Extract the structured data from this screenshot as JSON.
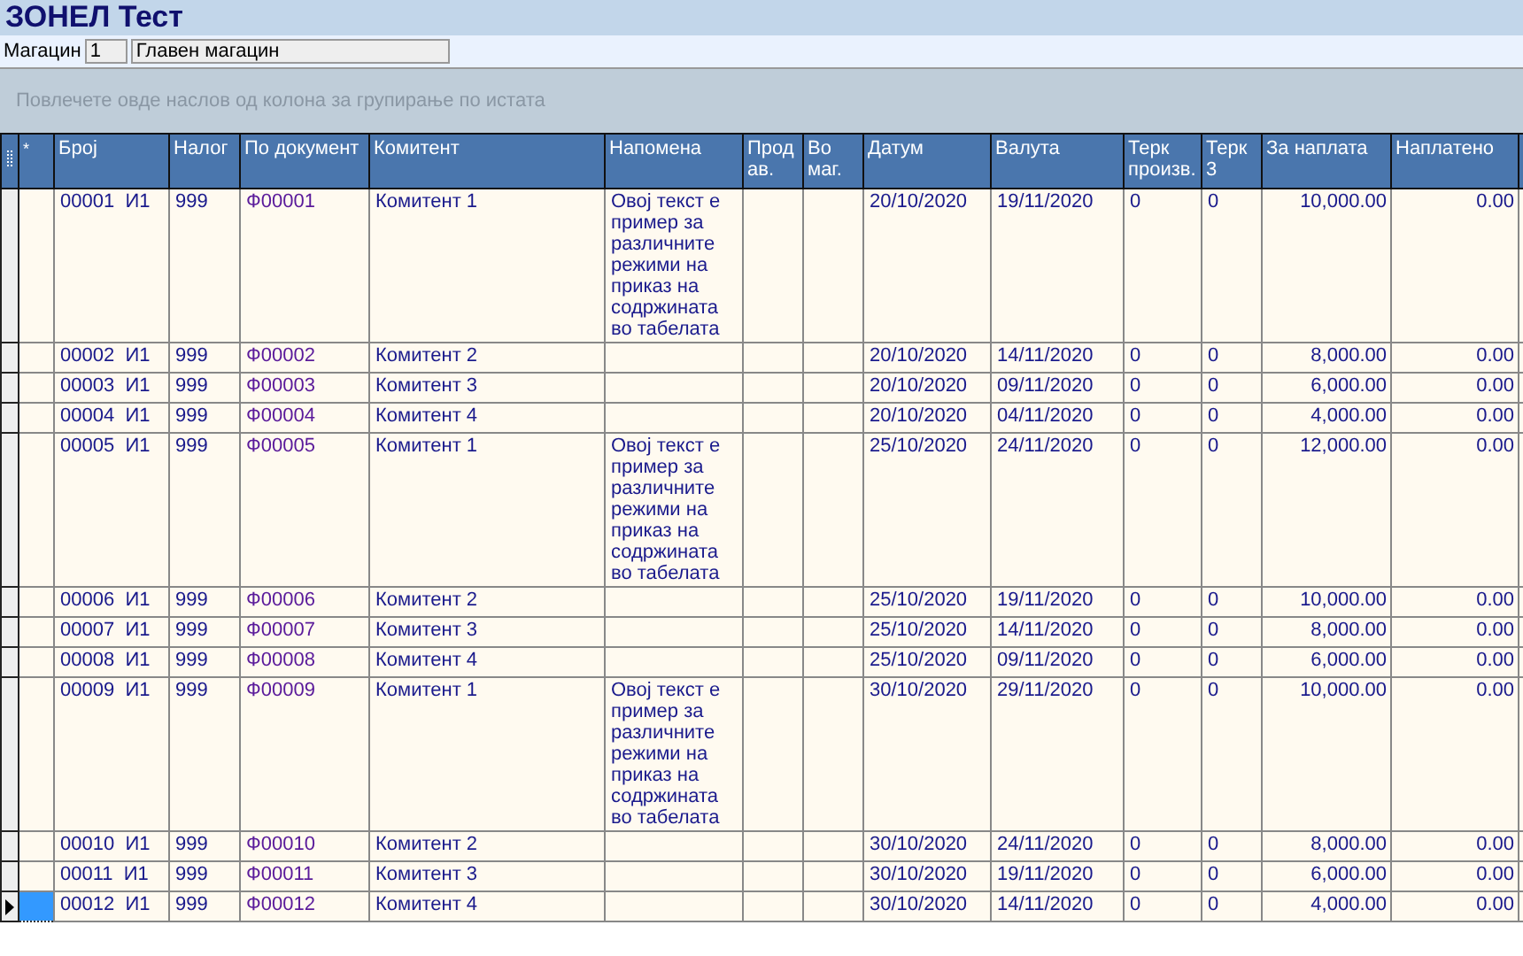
{
  "window": {
    "title": "ЗОНЕЛ Тест"
  },
  "warehouse": {
    "label": "Магацин",
    "code": "1",
    "name": "Главен магацин"
  },
  "group_panel": {
    "hint": "Повлечете овде наслов од колона за групирање по истата"
  },
  "table": {
    "columns": [
      "*",
      "Број",
      "Налог",
      "По документ",
      "Комитент",
      "Напомена",
      "Прод ав.",
      "Во маг.",
      "Датум",
      "Валута",
      "Терк произв.",
      "Терк 3",
      "За наплата",
      "Наплатено"
    ],
    "rows": [
      {
        "selected": false,
        "number": "00001  И1",
        "order": "999",
        "document": "Ф00001",
        "client": "Комитент 1",
        "note": "Овој текст е пример за различните режими на приказ на содржината во табелата",
        "date": "20/10/2020",
        "due": "19/11/2020",
        "t1": "0",
        "t3": "0",
        "to_pay": "10,000.00",
        "paid": "0.00"
      },
      {
        "selected": false,
        "number": "00002  И1",
        "order": "999",
        "document": "Ф00002",
        "client": "Комитент 2",
        "date": "20/10/2020",
        "due": "14/11/2020",
        "t1": "0",
        "t3": "0",
        "to_pay": "8,000.00",
        "paid": "0.00"
      },
      {
        "selected": false,
        "number": "00003  И1",
        "order": "999",
        "document": "Ф00003",
        "client": "Комитент 3",
        "date": "20/10/2020",
        "due": "09/11/2020",
        "t1": "0",
        "t3": "0",
        "to_pay": "6,000.00",
        "paid": "0.00"
      },
      {
        "selected": false,
        "number": "00004  И1",
        "order": "999",
        "document": "Ф00004",
        "client": "Комитент 4",
        "date": "20/10/2020",
        "due": "04/11/2020",
        "t1": "0",
        "t3": "0",
        "to_pay": "4,000.00",
        "paid": "0.00"
      },
      {
        "selected": false,
        "number": "00005  И1",
        "order": "999",
        "document": "Ф00005",
        "client": "Комитент 1",
        "note": "Овој текст е пример за различните режими на приказ на содржината во табелата",
        "date": "25/10/2020",
        "due": "24/11/2020",
        "t1": "0",
        "t3": "0",
        "to_pay": "12,000.00",
        "paid": "0.00"
      },
      {
        "selected": false,
        "number": "00006  И1",
        "order": "999",
        "document": "Ф00006",
        "client": "Комитент 2",
        "date": "25/10/2020",
        "due": "19/11/2020",
        "t1": "0",
        "t3": "0",
        "to_pay": "10,000.00",
        "paid": "0.00"
      },
      {
        "selected": false,
        "number": "00007  И1",
        "order": "999",
        "document": "Ф00007",
        "client": "Комитент 3",
        "date": "25/10/2020",
        "due": "14/11/2020",
        "t1": "0",
        "t3": "0",
        "to_pay": "8,000.00",
        "paid": "0.00"
      },
      {
        "selected": false,
        "number": "00008  И1",
        "order": "999",
        "document": "Ф00008",
        "client": "Комитент 4",
        "date": "25/10/2020",
        "due": "09/11/2020",
        "t1": "0",
        "t3": "0",
        "to_pay": "6,000.00",
        "paid": "0.00"
      },
      {
        "selected": false,
        "number": "00009  И1",
        "order": "999",
        "document": "Ф00009",
        "client": "Комитент 1",
        "note": "Овој текст е пример за различните режими на приказ на содржината во табелата",
        "date": "30/10/2020",
        "due": "29/11/2020",
        "t1": "0",
        "t3": "0",
        "to_pay": "10,000.00",
        "paid": "0.00"
      },
      {
        "selected": false,
        "number": "00010  И1",
        "order": "999",
        "document": "Ф00010",
        "client": "Комитент 2",
        "date": "30/10/2020",
        "due": "24/11/2020",
        "t1": "0",
        "t3": "0",
        "to_pay": "8,000.00",
        "paid": "0.00"
      },
      {
        "selected": false,
        "number": "00011  И1",
        "order": "999",
        "document": "Ф00011",
        "client": "Комитент 3",
        "date": "30/10/2020",
        "due": "19/11/2020",
        "t1": "0",
        "t3": "0",
        "to_pay": "6,000.00",
        "paid": "0.00"
      },
      {
        "selected": true,
        "number": "00012  И1",
        "order": "999",
        "document": "Ф00012",
        "client": "Комитент 4",
        "date": "30/10/2020",
        "due": "14/11/2020",
        "t1": "0",
        "t3": "0",
        "to_pay": "4,000.00",
        "paid": "0.00"
      }
    ]
  }
}
